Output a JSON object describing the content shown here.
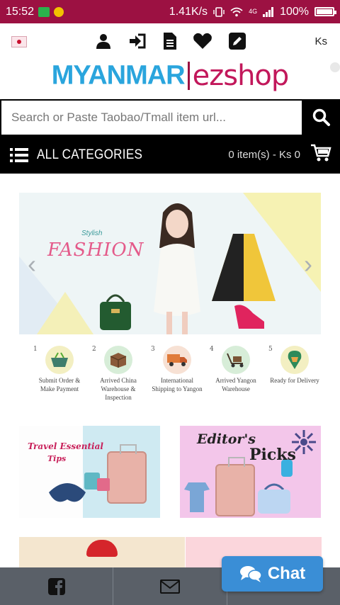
{
  "status_bar": {
    "time": "15:52",
    "speed": "1.41K/s",
    "battery": "100%",
    "network": "4G"
  },
  "header": {
    "currency": "Ks",
    "icons": [
      "user-icon",
      "login-icon",
      "document-icon",
      "heart-icon",
      "edit-icon"
    ]
  },
  "logo": {
    "part1": "MYANMAR",
    "part2": "ezshop"
  },
  "search": {
    "placeholder": "Search or Paste Taobao/Tmall item url..."
  },
  "categories": {
    "label": "ALL CATEGORIES",
    "cart_summary": "0 item(s) - Ks 0"
  },
  "banner": {
    "tagline": "Stylish",
    "title": "FASHION"
  },
  "steps": [
    {
      "num": "1",
      "text": "Submit Order & Make Payment",
      "color": "#f3efc2"
    },
    {
      "num": "2",
      "text": "Arrived China Warehouse & Inspection",
      "color": "#d7edd8"
    },
    {
      "num": "3",
      "text": "International Shipping to Yangon",
      "color": "#f7e1d4"
    },
    {
      "num": "4",
      "text": "Arrived Yangon Warehouse",
      "color": "#d7edd8"
    },
    {
      "num": "5",
      "text": "Ready for Delivery",
      "color": "#f3efc2"
    }
  ],
  "promos": {
    "travel_title": "Travel Essential",
    "travel_sub": "Tips",
    "editor_title": "Editor's",
    "editor_sub": "Picks"
  },
  "chat": {
    "label": "Chat"
  },
  "colors": {
    "status_bar": "#9c1142",
    "logo_blue": "#2aa5dd",
    "logo_magenta": "#c2185b",
    "chat_blue": "#3a8ed6",
    "bottom_bar": "#5a6068"
  }
}
